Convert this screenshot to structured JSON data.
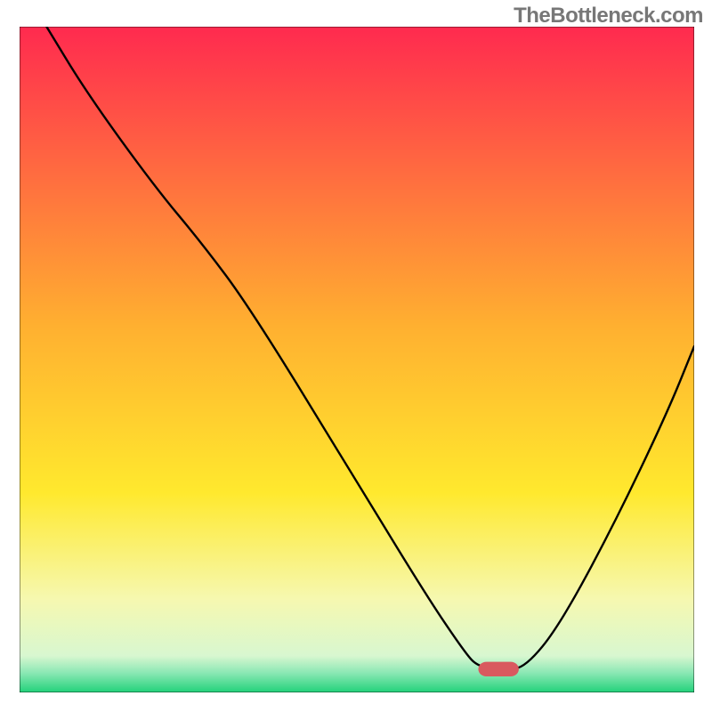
{
  "watermark": "TheBottleneck.com",
  "chart_data": {
    "type": "line",
    "title": "",
    "xlabel": "",
    "ylabel": "",
    "xlim": [
      0,
      100
    ],
    "ylim": [
      0,
      100
    ],
    "gradient": {
      "stops": [
        {
          "offset": 0,
          "color": "#ff2a4f"
        },
        {
          "offset": 0.45,
          "color": "#ffb030"
        },
        {
          "offset": 0.7,
          "color": "#ffe92e"
        },
        {
          "offset": 0.86,
          "color": "#f6f8b0"
        },
        {
          "offset": 0.945,
          "color": "#d8f7d0"
        },
        {
          "offset": 0.97,
          "color": "#8de8b5"
        },
        {
          "offset": 1.0,
          "color": "#22d27a"
        }
      ]
    },
    "marker": {
      "x": 71,
      "y": 96.5,
      "color": "#d9595f"
    },
    "series": [
      {
        "name": "curve",
        "points": [
          {
            "x": 4,
            "y": 0
          },
          {
            "x": 10,
            "y": 10
          },
          {
            "x": 20,
            "y": 24
          },
          {
            "x": 27,
            "y": 32.5
          },
          {
            "x": 34,
            "y": 42
          },
          {
            "x": 48,
            "y": 65
          },
          {
            "x": 60,
            "y": 85
          },
          {
            "x": 66,
            "y": 94
          },
          {
            "x": 68,
            "y": 96.2
          },
          {
            "x": 72,
            "y": 96.6
          },
          {
            "x": 75,
            "y": 96.2
          },
          {
            "x": 80,
            "y": 90
          },
          {
            "x": 88,
            "y": 75
          },
          {
            "x": 96,
            "y": 58
          },
          {
            "x": 100,
            "y": 48
          }
        ]
      }
    ]
  }
}
